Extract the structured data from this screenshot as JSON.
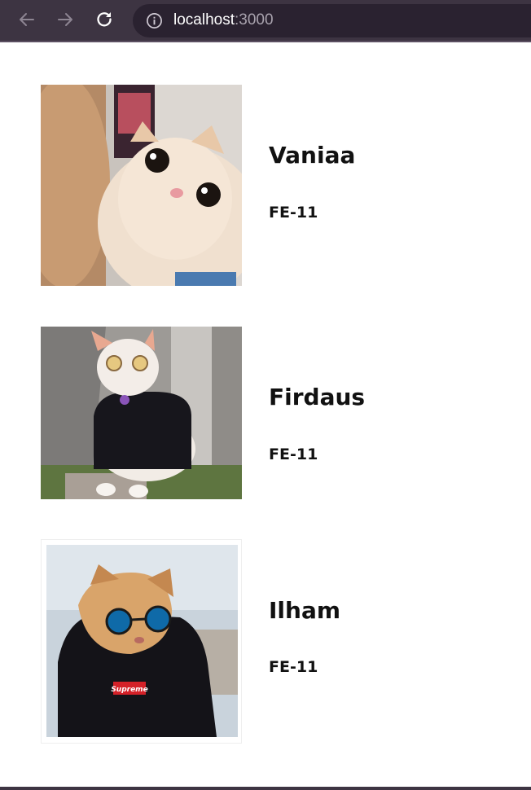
{
  "browser": {
    "url_host": "localhost",
    "url_port": ":3000",
    "icons": {
      "back": "arrow-left-icon",
      "forward": "arrow-right-icon",
      "reload": "reload-icon",
      "site_info": "info-icon"
    },
    "colors": {
      "chrome": "#3d3442",
      "omnibox": "#2a2230"
    }
  },
  "profiles": [
    {
      "name": "Vaniaa",
      "group": "FE-11",
      "photo": "cat-selfie-photo"
    },
    {
      "name": "Firdaus",
      "group": "FE-11",
      "photo": "cat-with-glasses-photo"
    },
    {
      "name": "Ilham",
      "group": "FE-11",
      "photo": "cat-in-supreme-hoodie-photo"
    }
  ]
}
